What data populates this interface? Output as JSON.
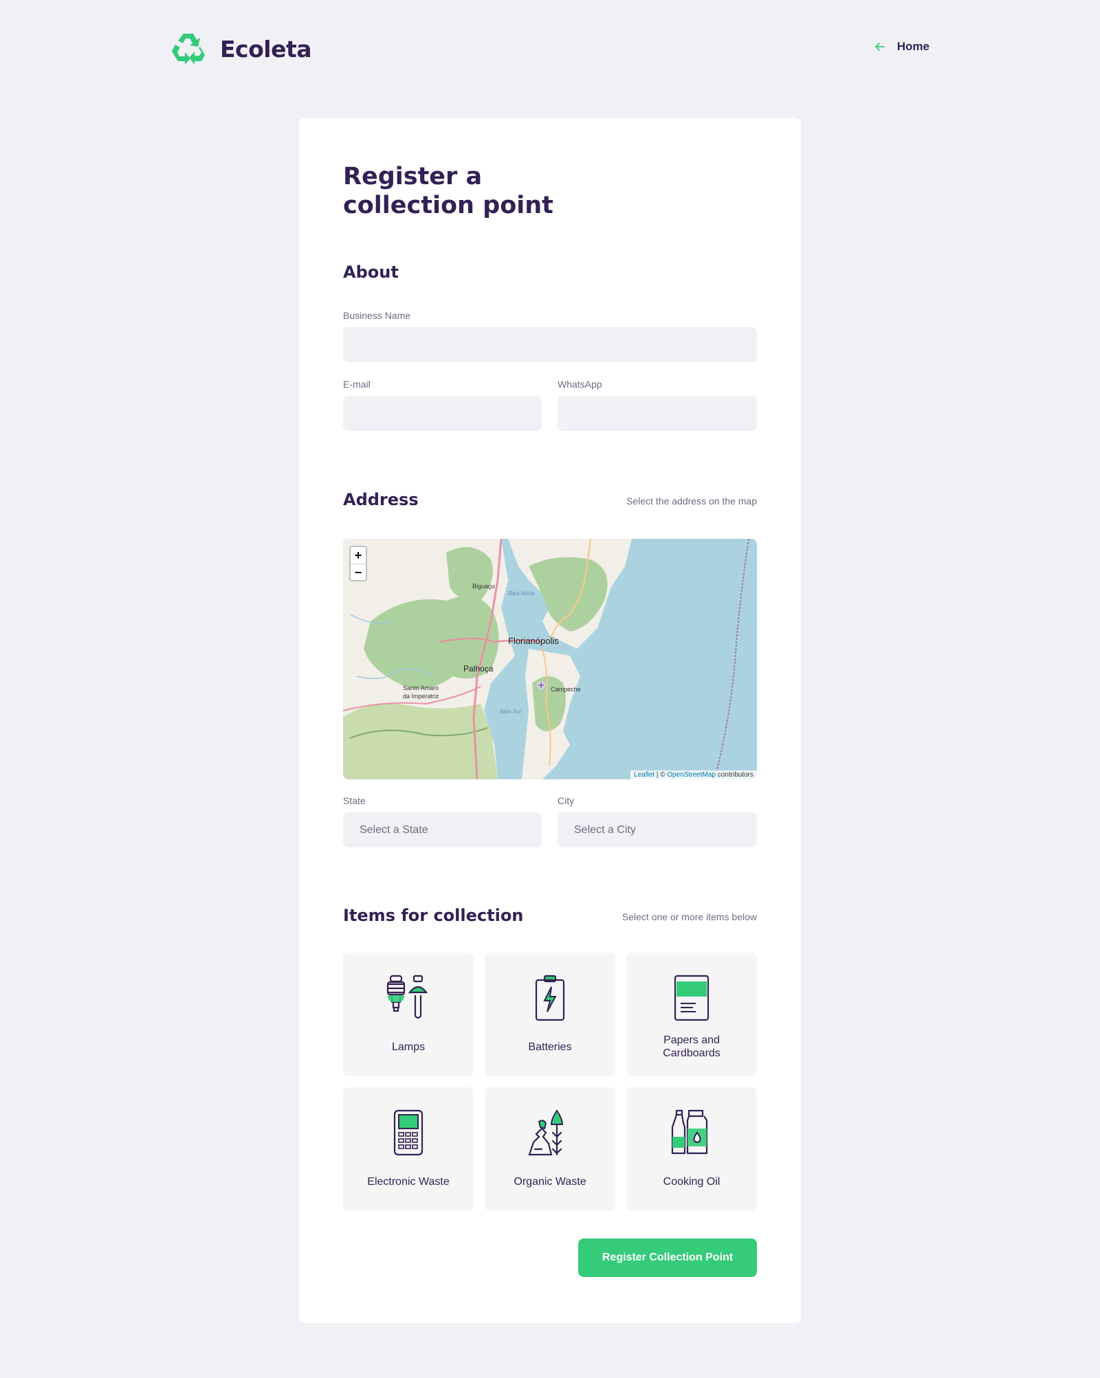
{
  "header": {
    "brand": "Ecoleta",
    "home_label": "Home"
  },
  "form": {
    "title": "Register a collection point",
    "about": {
      "legend": "About",
      "business_name_label": "Business Name",
      "business_name_value": "",
      "email_label": "E-mail",
      "email_value": "",
      "whatsapp_label": "WhatsApp",
      "whatsapp_value": ""
    },
    "address": {
      "legend": "Address",
      "hint": "Select the address on the map",
      "state_label": "State",
      "state_value": "Select a State",
      "city_label": "City",
      "city_value": "Select a City"
    },
    "map": {
      "zoom_in": "+",
      "zoom_out": "−",
      "places": {
        "biguacu": "Biguaçu",
        "baia_norte": "Baía Norte",
        "florianopolis": "Florianópolis",
        "palhoca": "Palhoça",
        "santo_amaro_1": "Santo Amaro",
        "santo_amaro_2": "da Imperatriz",
        "campeche": "Campeche",
        "baia_sul": "Baía Sul"
      },
      "attribution": {
        "leaflet": "Leaflet",
        "separator": " | © ",
        "osm": "OpenStreetMap",
        "suffix": " contributors"
      }
    },
    "items": {
      "legend": "Items for collection",
      "hint": "Select one or more items below",
      "list": [
        {
          "label": "Lamps",
          "icon": "lamps-icon"
        },
        {
          "label": "Batteries",
          "icon": "battery-icon"
        },
        {
          "label": "Papers and Cardboards",
          "icon": "paper-icon"
        },
        {
          "label": "Electronic Waste",
          "icon": "electronic-icon"
        },
        {
          "label": "Organic Waste",
          "icon": "organic-icon"
        },
        {
          "label": "Cooking Oil",
          "icon": "oil-icon"
        }
      ]
    },
    "submit_label": "Register Collection Point"
  },
  "colors": {
    "background": "#f0f0f5",
    "primary": "#34cb79",
    "title": "#322153",
    "muted": "#6c6c80"
  }
}
